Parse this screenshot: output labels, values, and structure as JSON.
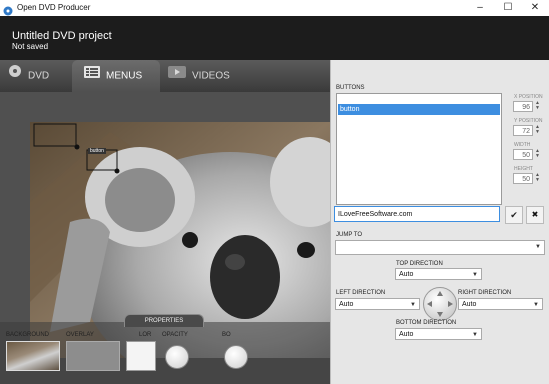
{
  "window": {
    "title": "Open DVD Producer",
    "controls": [
      "–",
      "☐",
      "✕"
    ]
  },
  "header": {
    "project_title": "Untitled DVD project",
    "status": "Not saved"
  },
  "tabs": [
    {
      "label": "DVD",
      "icon": "disc-icon"
    },
    {
      "label": "MENUS",
      "icon": "menu-icon",
      "active": true
    },
    {
      "label": "VIDEOS",
      "icon": "video-icon"
    }
  ],
  "preview": {
    "overlay_button_text": "button"
  },
  "properties": {
    "tab_label": "PROPERTIES",
    "background_label": "BACKGROUND",
    "overlay_label": "OVERLAY",
    "color_label": "LOR",
    "opacity_label": "OPACITY",
    "fourth_label": "BO"
  },
  "panel": {
    "buttons_label": "BUTTONS",
    "buttons": [
      "button"
    ],
    "x_label": "X POSITION",
    "x_value": "96",
    "y_label": "Y POSITION",
    "y_value": "72",
    "width_label": "WIDTH",
    "width_value": "50",
    "height_label": "HEIGHT",
    "height_value": "50",
    "name_value": "ILoveFreeSoftware.com",
    "confirm_glyph": "✔",
    "delete_glyph": "✖",
    "jump_label": "JUMP TO",
    "top_direction_label": "TOP DIRECTION",
    "top_direction": "Auto",
    "left_direction_label": "LEFT DIRECTION",
    "left_direction": "Auto",
    "right_direction_label": "RIGHT DIRECTION",
    "right_direction": "Auto",
    "bottom_direction_label": "BOTTOM DIRECTION",
    "bottom_direction": "Auto"
  },
  "colors": {
    "accent": "#3d8ee0",
    "header": "#1c1c1c"
  }
}
